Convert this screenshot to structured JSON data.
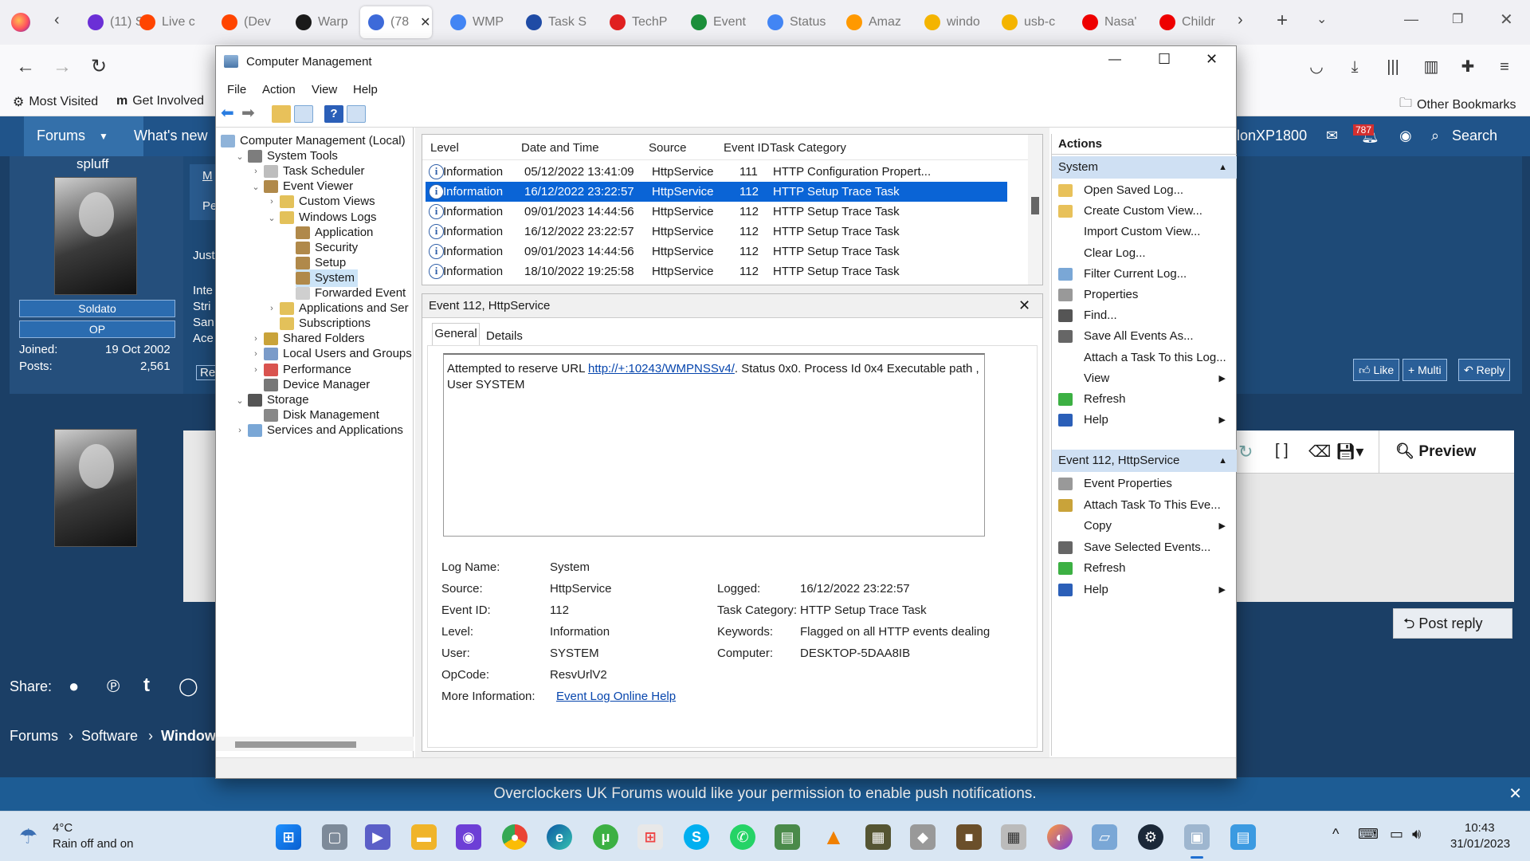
{
  "browser": {
    "tabs": [
      {
        "label": "(11) S"
      },
      {
        "label": "Live c"
      },
      {
        "label": "(Dev"
      },
      {
        "label": "Warp"
      },
      {
        "label": "(78"
      },
      {
        "label": "WMP"
      },
      {
        "label": "Task S"
      },
      {
        "label": "TechP"
      },
      {
        "label": "Event"
      },
      {
        "label": "Status"
      },
      {
        "label": "Amaz"
      },
      {
        "label": "windo"
      },
      {
        "label": "usb-c"
      },
      {
        "label": "Nasa'"
      },
      {
        "label": "Childr"
      }
    ],
    "bookmarks": {
      "most_visited": "Most Visited",
      "get_involved": "Get Involved",
      "other": "Other Bookmarks"
    }
  },
  "forum": {
    "nav": {
      "forums": "Forums",
      "whats_new": "What's new",
      "user": "lonXP1800",
      "alerts": "787",
      "search": "Search"
    },
    "user": {
      "name": "spluff",
      "rank": "Soldato",
      "op": "OP",
      "joined_label": "Joined:",
      "joined": "19 Oct 2002",
      "posts_label": "Posts:",
      "posts": "2,561"
    },
    "post_snippets": [
      "M",
      "Pe",
      "Just",
      "Inte",
      "Stri",
      "San",
      "Ace",
      "Rep"
    ],
    "buttons": {
      "like": "Like",
      "multi": "Multi",
      "reply": "Reply",
      "preview": "Preview",
      "post_reply": "Post reply"
    },
    "share": "Share:",
    "breadcrumb": [
      "Forums",
      "Software",
      "Window"
    ],
    "notification": "Overclockers UK Forums would like your permission to enable push notifications."
  },
  "window": {
    "title": "Computer Management",
    "menu": [
      "File",
      "Action",
      "View",
      "Help"
    ],
    "tree": [
      {
        "label": "Computer Management (Local)",
        "level": 0
      },
      {
        "label": "System Tools",
        "level": 1
      },
      {
        "label": "Task Scheduler",
        "level": 2
      },
      {
        "label": "Event Viewer",
        "level": 2
      },
      {
        "label": "Custom Views",
        "level": 3
      },
      {
        "label": "Windows Logs",
        "level": 3
      },
      {
        "label": "Application",
        "level": 4
      },
      {
        "label": "Security",
        "level": 4
      },
      {
        "label": "Setup",
        "level": 4
      },
      {
        "label": "System",
        "level": 4
      },
      {
        "label": "Forwarded Event",
        "level": 4
      },
      {
        "label": "Applications and Ser",
        "level": 3
      },
      {
        "label": "Subscriptions",
        "level": 3
      },
      {
        "label": "Shared Folders",
        "level": 2
      },
      {
        "label": "Local Users and Groups",
        "level": 2
      },
      {
        "label": "Performance",
        "level": 2
      },
      {
        "label": "Device Manager",
        "level": 2
      },
      {
        "label": "Storage",
        "level": 1
      },
      {
        "label": "Disk Management",
        "level": 2
      },
      {
        "label": "Services and Applications",
        "level": 1
      }
    ],
    "events": {
      "columns": [
        "Level",
        "Date and Time",
        "Source",
        "Event ID",
        "Task Category"
      ],
      "rows": [
        [
          "Information",
          "05/12/2022 13:41:09",
          "HttpService",
          "111",
          "HTTP Configuration Propert..."
        ],
        [
          "Information",
          "16/12/2022 23:22:57",
          "HttpService",
          "112",
          "HTTP Setup Trace Task"
        ],
        [
          "Information",
          "09/01/2023 14:44:56",
          "HttpService",
          "112",
          "HTTP Setup Trace Task"
        ],
        [
          "Information",
          "16/12/2022 23:22:57",
          "HttpService",
          "112",
          "HTTP Setup Trace Task"
        ],
        [
          "Information",
          "09/01/2023 14:44:56",
          "HttpService",
          "112",
          "HTTP Setup Trace Task"
        ],
        [
          "Information",
          "18/10/2022 19:25:58",
          "HttpService",
          "112",
          "HTTP Setup Trace Task"
        ]
      ],
      "selected_row": 1
    },
    "detail": {
      "title": "Event 112, HttpService",
      "tabs": [
        "General",
        "Details"
      ],
      "message_pre": "Attempted to reserve URL ",
      "message_link": "http://+:10243/WMPNSSv4/",
      "message_post": ". Status 0x0. Process Id 0x4 Executable path , User SYSTEM",
      "fields": {
        "log_name_label": "Log Name:",
        "log_name": "System",
        "source_label": "Source:",
        "source": "HttpService",
        "logged_label": "Logged:",
        "logged": "16/12/2022 23:22:57",
        "event_id_label": "Event ID:",
        "event_id": "112",
        "task_category_label": "Task Category:",
        "task_category": "HTTP Setup Trace Task",
        "level_label": "Level:",
        "level": "Information",
        "keywords_label": "Keywords:",
        "keywords": "Flagged on all HTTP events dealing",
        "user_label": "User:",
        "user": "SYSTEM",
        "computer_label": "Computer:",
        "computer": "DESKTOP-5DAA8IB",
        "opcode_label": "OpCode:",
        "opcode": "ResvUrlV2",
        "more_info_label": "More Information:",
        "more_info_link": "Event Log Online Help"
      }
    },
    "actions": {
      "header": "Actions",
      "section1": "System",
      "items1": [
        {
          "label": "Open Saved Log...",
          "sub": false
        },
        {
          "label": "Create Custom View...",
          "sub": false
        },
        {
          "label": "Import Custom View...",
          "sub": false
        },
        {
          "label": "Clear Log...",
          "sub": false
        },
        {
          "label": "Filter Current Log...",
          "sub": false
        },
        {
          "label": "Properties",
          "sub": false
        },
        {
          "label": "Find...",
          "sub": false
        },
        {
          "label": "Save All Events As...",
          "sub": false
        },
        {
          "label": "Attach a Task To this Log...",
          "sub": false
        },
        {
          "label": "View",
          "sub": true
        },
        {
          "label": "Refresh",
          "sub": false
        },
        {
          "label": "Help",
          "sub": true
        }
      ],
      "section2": "Event 112, HttpService",
      "items2": [
        {
          "label": "Event Properties",
          "sub": false
        },
        {
          "label": "Attach Task To This Eve...",
          "sub": false
        },
        {
          "label": "Copy",
          "sub": true
        },
        {
          "label": "Save Selected Events...",
          "sub": false
        },
        {
          "label": "Refresh",
          "sub": false
        },
        {
          "label": "Help",
          "sub": true
        }
      ]
    }
  },
  "taskbar": {
    "weather_temp": "4°C",
    "weather_desc": "Rain off and on",
    "time": "10:43",
    "date": "31/01/2023"
  }
}
